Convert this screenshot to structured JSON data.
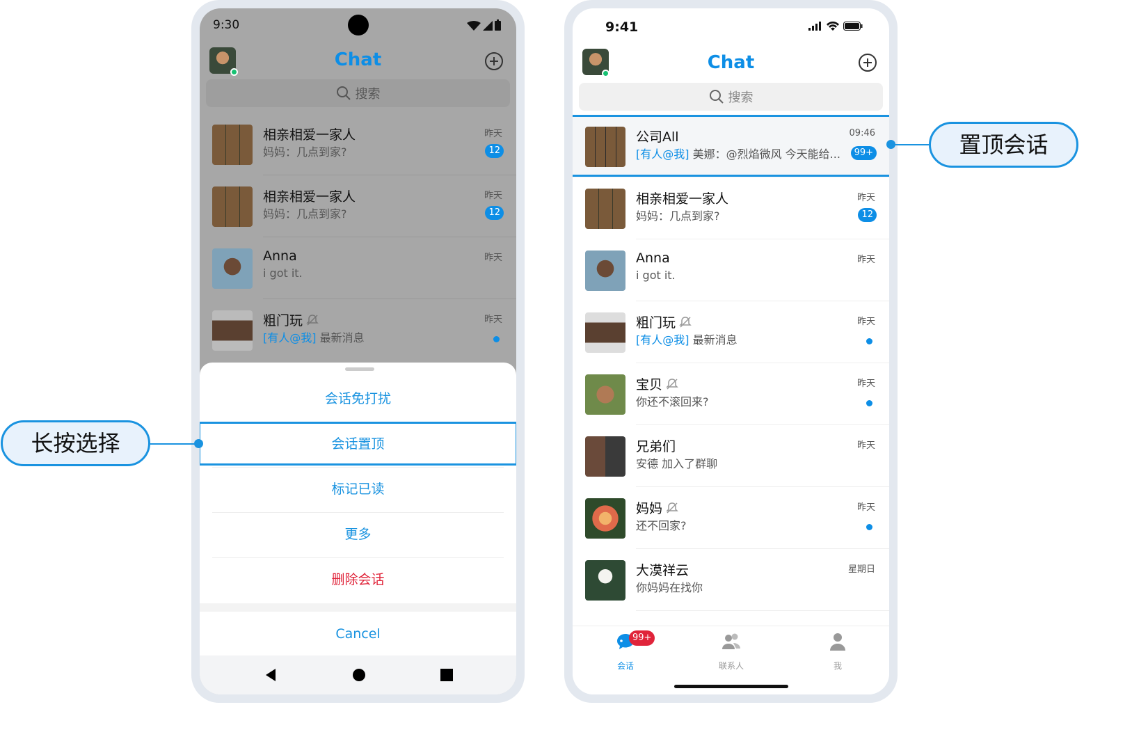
{
  "colors": {
    "accent": "#0d8ee6",
    "danger": "#e0243a",
    "online": "#16c172"
  },
  "android": {
    "status_time": "9:30",
    "title": "Chat",
    "search_placeholder": "搜索",
    "chats": [
      {
        "name": "相亲相爱一家人",
        "preview": "妈妈：几点到家?",
        "time": "昨天",
        "badge": "12"
      },
      {
        "name": "相亲相爱一家人",
        "preview": "妈妈：几点到家?",
        "time": "昨天",
        "badge": "12"
      },
      {
        "name": "Anna",
        "preview": "i got it.",
        "time": "昨天"
      },
      {
        "name": "粗门玩",
        "mention": "[有人@我]",
        "preview": "最新消息",
        "time": "昨天",
        "muted": true
      }
    ],
    "sheet": {
      "options": [
        "会话免打扰",
        "会话置顶",
        "标记已读",
        "更多",
        "删除会话"
      ],
      "cancel": "Cancel"
    }
  },
  "ios": {
    "status_time": "9:41",
    "title": "Chat",
    "search_placeholder": "搜索",
    "chats": [
      {
        "name": "公司All",
        "mention": "[有人@我]",
        "preview": "美娜：@烈焰微风 今天能给...",
        "time": "09:46",
        "badge": "99+",
        "pinned": true
      },
      {
        "name": "相亲相爱一家人",
        "preview": "妈妈：几点到家?",
        "time": "昨天",
        "badge": "12"
      },
      {
        "name": "Anna",
        "preview": "i got it.",
        "time": "昨天"
      },
      {
        "name": "粗门玩",
        "mention": "[有人@我]",
        "preview": "最新消息",
        "time": "昨天",
        "muted": true
      },
      {
        "name": "宝贝",
        "preview": "你还不滚回来?",
        "time": "昨天",
        "muted": true
      },
      {
        "name": "兄弟们",
        "preview": "安德 加入了群聊",
        "time": "昨天"
      },
      {
        "name": "妈妈",
        "preview": "还不回家?",
        "time": "昨天",
        "muted": true
      },
      {
        "name": "大漠祥云",
        "preview": "你妈妈在找你",
        "time": "星期日"
      }
    ],
    "tabs": [
      {
        "label": "会话",
        "icon": "chat-bubble-icon",
        "badge": "99+",
        "active": true
      },
      {
        "label": "联系人",
        "icon": "contacts-icon"
      },
      {
        "label": "我",
        "icon": "person-icon"
      }
    ]
  },
  "callouts": {
    "long_press": "长按选择",
    "pinned_chat": "置顶会话"
  }
}
